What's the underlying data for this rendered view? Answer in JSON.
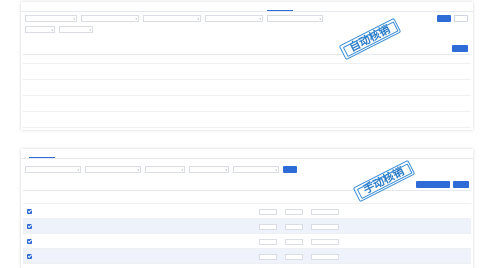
{
  "top": {
    "tabs": [
      {
        "label": ""
      },
      {
        "label": ""
      },
      {
        "label": ""
      },
      {
        "label": ""
      },
      {
        "label": ""
      },
      {
        "label": ""
      },
      {
        "label": ""
      },
      {
        "label": "",
        "active": true
      }
    ],
    "filters": [
      {
        "value": ""
      },
      {
        "value": ""
      },
      {
        "value": ""
      },
      {
        "value": ""
      },
      {
        "value": ""
      },
      {
        "value": ""
      },
      {
        "value": ""
      }
    ],
    "search_button": "",
    "reset_button": "",
    "section_label": "",
    "export_button": "",
    "columns": [
      "",
      "",
      "",
      "",
      "",
      "",
      "",
      "",
      "",
      "",
      "",
      "",
      "",
      ""
    ],
    "rows": [
      [
        "",
        "",
        "",
        "",
        "",
        "",
        "",
        "",
        "",
        "",
        "",
        "",
        "",
        ""
      ],
      [
        "",
        "",
        "",
        "",
        "",
        "",
        "",
        "",
        "",
        "",
        "",
        "",
        "",
        ""
      ],
      [
        "",
        "",
        "",
        "",
        "",
        "",
        "",
        "",
        "",
        "",
        "",
        "",
        "",
        ""
      ],
      [
        "",
        "",
        "",
        "",
        "",
        "",
        "",
        "",
        "",
        "",
        "",
        "",
        "",
        ""
      ]
    ]
  },
  "bottom": {
    "tabs": [
      {
        "label": "",
        "active": true
      },
      {
        "label": ""
      },
      {
        "label": ""
      },
      {
        "label": ""
      },
      {
        "label": ""
      },
      {
        "label": ""
      },
      {
        "label": ""
      },
      {
        "label": ""
      },
      {
        "label": ""
      }
    ],
    "filters": [
      {
        "value": ""
      },
      {
        "value": ""
      },
      {
        "value": ""
      },
      {
        "value": ""
      },
      {
        "value": ""
      }
    ],
    "search_button": "",
    "list_label": "",
    "list_sublabel": "",
    "action_button": "",
    "import_button": "",
    "columns": [
      "",
      "",
      "",
      "",
      "",
      "",
      "",
      "",
      "",
      "",
      "",
      "",
      "",
      "",
      "",
      "",
      ""
    ],
    "rows": [
      [
        "",
        "",
        "",
        "",
        "",
        "",
        "",
        "",
        "",
        "",
        "",
        "",
        "",
        "",
        "",
        "",
        ""
      ],
      [
        "",
        "",
        "",
        "",
        "",
        "",
        "",
        "",
        "",
        "",
        "",
        "",
        "",
        "",
        "",
        "",
        ""
      ],
      [
        "",
        "",
        "",
        "",
        "",
        "",
        "",
        "",
        "",
        "",
        "",
        "",
        "",
        "",
        "",
        "",
        ""
      ],
      [
        "",
        "",
        "",
        "",
        "",
        "",
        "",
        "",
        "",
        "",
        "",
        "",
        "",
        "",
        "",
        "",
        ""
      ]
    ]
  },
  "stamps": {
    "auto": "自动核销",
    "manual": "手动核销"
  },
  "colors": {
    "accent": "#2f6bd6",
    "stamp": "#3a8dd6",
    "row_highlight": "#eef3fb"
  }
}
